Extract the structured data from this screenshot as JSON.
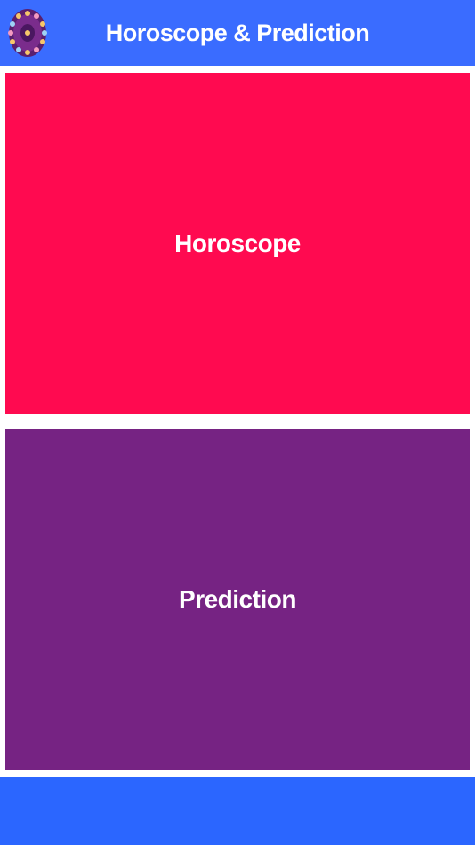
{
  "header": {
    "title": "Horoscope & Prediction",
    "logo_icon": "zodiac-wheel-icon",
    "background_color": "#3a6cff"
  },
  "menu": {
    "tiles": [
      {
        "label": "Horoscope",
        "color": "#ff0a50"
      },
      {
        "label": "Prediction",
        "color": "#762383"
      }
    ]
  },
  "footer": {
    "background_color": "#2b66ff"
  }
}
